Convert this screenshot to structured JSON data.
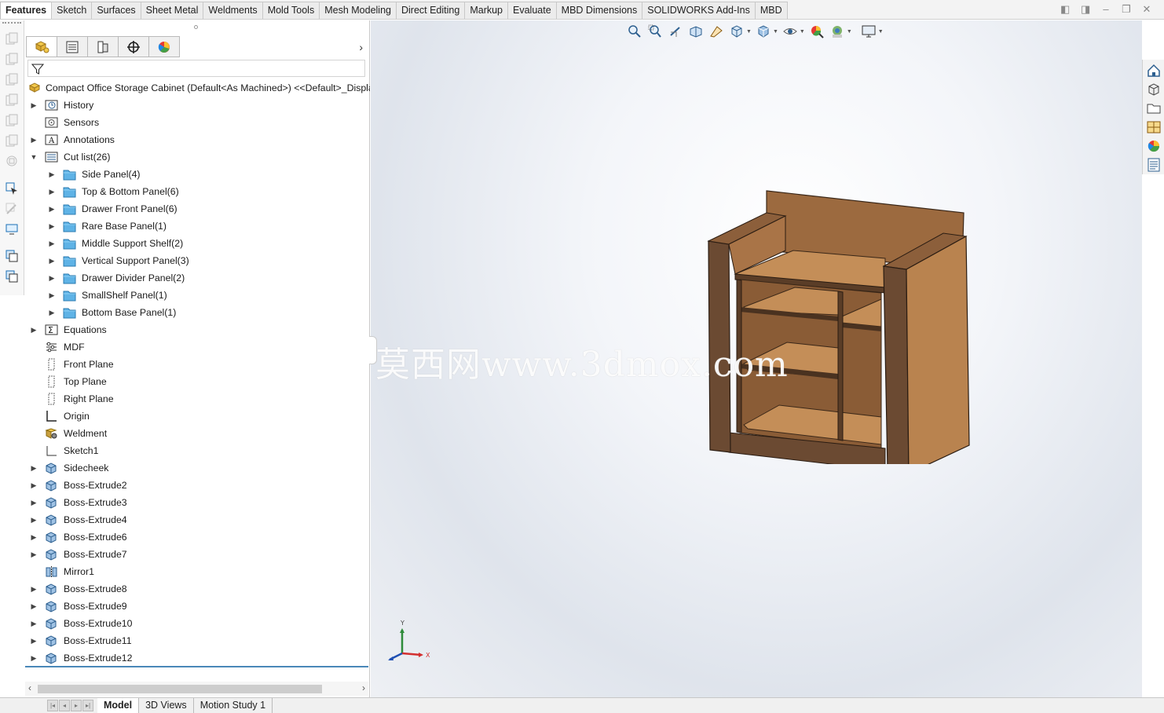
{
  "command_manager": {
    "tabs": [
      "Features",
      "Sketch",
      "Surfaces",
      "Sheet Metal",
      "Weldments",
      "Mold Tools",
      "Mesh Modeling",
      "Direct Editing",
      "Markup",
      "Evaluate",
      "MBD Dimensions",
      "SOLIDWORKS Add-Ins",
      "MBD"
    ],
    "active_tab": "Features"
  },
  "feature_manager": {
    "panel_tabs": [
      "featuremanager-tree-icon",
      "propertymanager-icon",
      "configurationmanager-icon",
      "dimxpertmanager-icon",
      "displaymanager-icon"
    ],
    "root_label": "Compact Office Storage Cabinet (Default<As Machined>) <<Default>_Display",
    "items": [
      {
        "label": "History",
        "icon": "history-icon",
        "level": 0,
        "expander": "collapsed"
      },
      {
        "label": "Sensors",
        "icon": "sensors-icon",
        "level": 0,
        "expander": "none"
      },
      {
        "label": "Annotations",
        "icon": "annotations-icon",
        "level": 0,
        "expander": "collapsed"
      },
      {
        "label": "Cut list(26)",
        "icon": "cutlist-icon",
        "level": 0,
        "expander": "expanded"
      },
      {
        "label": "Side Panel(4)",
        "icon": "folder-icon",
        "level": 1,
        "expander": "collapsed"
      },
      {
        "label": "Top & Bottom Panel(6)",
        "icon": "folder-icon",
        "level": 1,
        "expander": "collapsed"
      },
      {
        "label": "Drawer Front Panel(6)",
        "icon": "folder-icon",
        "level": 1,
        "expander": "collapsed"
      },
      {
        "label": "Rare Base Panel(1)",
        "icon": "folder-icon",
        "level": 1,
        "expander": "collapsed"
      },
      {
        "label": "Middle Support Shelf(2)",
        "icon": "folder-icon",
        "level": 1,
        "expander": "collapsed"
      },
      {
        "label": "Vertical Support Panel(3)",
        "icon": "folder-icon",
        "level": 1,
        "expander": "collapsed"
      },
      {
        "label": "Drawer Divider Panel(2)",
        "icon": "folder-icon",
        "level": 1,
        "expander": "collapsed"
      },
      {
        "label": "SmallShelf Panel(1)",
        "icon": "folder-icon",
        "level": 1,
        "expander": "collapsed"
      },
      {
        "label": "Bottom Base Panel(1)",
        "icon": "folder-icon",
        "level": 1,
        "expander": "collapsed"
      },
      {
        "label": "Equations",
        "icon": "equations-icon",
        "level": 0,
        "expander": "collapsed"
      },
      {
        "label": "MDF",
        "icon": "material-icon",
        "level": 0,
        "expander": "none"
      },
      {
        "label": "Front Plane",
        "icon": "plane-icon",
        "level": 0,
        "expander": "none"
      },
      {
        "label": "Top Plane",
        "icon": "plane-icon",
        "level": 0,
        "expander": "none"
      },
      {
        "label": "Right Plane",
        "icon": "plane-icon",
        "level": 0,
        "expander": "none"
      },
      {
        "label": "Origin",
        "icon": "origin-icon",
        "level": 0,
        "expander": "none"
      },
      {
        "label": "Weldment",
        "icon": "weldment-icon",
        "level": 0,
        "expander": "none"
      },
      {
        "label": "Sketch1",
        "icon": "sketch-icon",
        "level": 0,
        "expander": "none"
      },
      {
        "label": "Sidecheek",
        "icon": "extrude-icon",
        "level": 0,
        "expander": "collapsed"
      },
      {
        "label": "Boss-Extrude2",
        "icon": "extrude-icon",
        "level": 0,
        "expander": "collapsed"
      },
      {
        "label": "Boss-Extrude3",
        "icon": "extrude-icon",
        "level": 0,
        "expander": "collapsed"
      },
      {
        "label": "Boss-Extrude4",
        "icon": "extrude-icon",
        "level": 0,
        "expander": "collapsed"
      },
      {
        "label": "Boss-Extrude6",
        "icon": "extrude-icon",
        "level": 0,
        "expander": "collapsed"
      },
      {
        "label": "Boss-Extrude7",
        "icon": "extrude-icon",
        "level": 0,
        "expander": "collapsed"
      },
      {
        "label": "Mirror1",
        "icon": "mirror-icon",
        "level": 0,
        "expander": "none"
      },
      {
        "label": "Boss-Extrude8",
        "icon": "extrude-icon",
        "level": 0,
        "expander": "collapsed"
      },
      {
        "label": "Boss-Extrude9",
        "icon": "extrude-icon",
        "level": 0,
        "expander": "collapsed"
      },
      {
        "label": "Boss-Extrude10",
        "icon": "extrude-icon",
        "level": 0,
        "expander": "collapsed"
      },
      {
        "label": "Boss-Extrude11",
        "icon": "extrude-icon",
        "level": 0,
        "expander": "collapsed"
      },
      {
        "label": "Boss-Extrude12",
        "icon": "extrude-icon",
        "level": 0,
        "expander": "collapsed"
      }
    ]
  },
  "viewport": {
    "watermark": "莫西网www.3dmox.com",
    "triad": {
      "x_label": "X",
      "y_label": "Y"
    },
    "heads_up_toolbar": [
      "zoom-to-fit-icon",
      "zoom-to-area-icon",
      "previous-view-icon",
      "section-view-icon",
      "dynamic-annotation-icon",
      "view-orientation-icon",
      "display-style-icon",
      "hide-show-icon",
      "edit-appearance-icon",
      "apply-scene-icon",
      "view-settings-icon"
    ]
  },
  "task_pane": [
    "home-icon",
    "3d-content-icon",
    "file-explorer-icon",
    "view-palette-icon",
    "appearances-icon",
    "custom-properties-icon"
  ],
  "bottom_tabs": {
    "tabs": [
      "Model",
      "3D Views",
      "Motion Study 1"
    ],
    "active_tab": "Model"
  },
  "colors": {
    "wood_light": "#b9834f",
    "wood_dark": "#6b4a32",
    "folder_blue": "#5fb3e6",
    "accent_line": "#4a88b8"
  }
}
